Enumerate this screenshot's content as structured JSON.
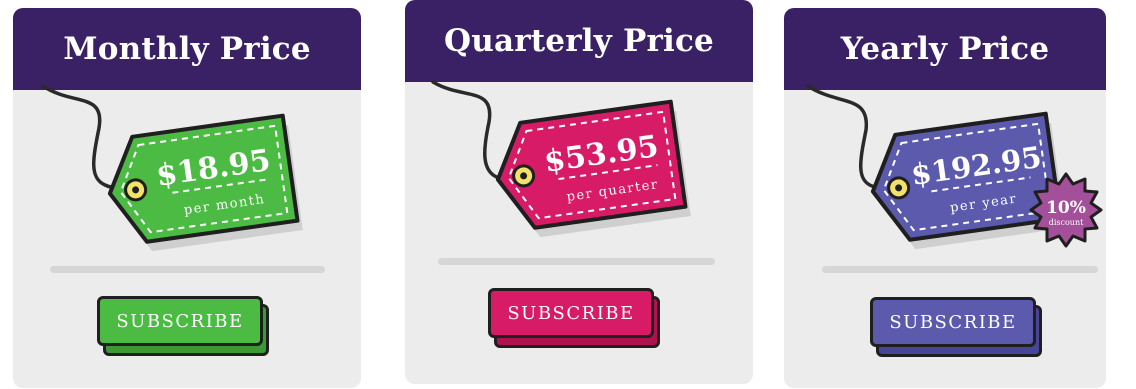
{
  "plans": [
    {
      "title": "Monthly Price",
      "price": "$18.95",
      "period": "per month",
      "button_label": "SUBSCRIBE",
      "color": "#4cbb44",
      "color_dark": "#3a9a34"
    },
    {
      "title": "Quarterly Price",
      "price": "$53.95",
      "period": "per quarter",
      "button_label": "SUBSCRIBE",
      "color": "#d81b66",
      "color_dark": "#b0124f"
    },
    {
      "title": "Yearly Price",
      "price": "$192.95",
      "period": "per year",
      "button_label": "SUBSCRIBE",
      "color": "#5c5aad",
      "color_dark": "#47459a",
      "badge": {
        "value": "10%",
        "label": "discount",
        "color": "#a44f9a"
      }
    }
  ],
  "colors": {
    "header": "#3a2166",
    "card": "#ececec",
    "outline": "#1f1f1f",
    "string": "#2a2a2a",
    "eyelet": "#f2e26a"
  }
}
